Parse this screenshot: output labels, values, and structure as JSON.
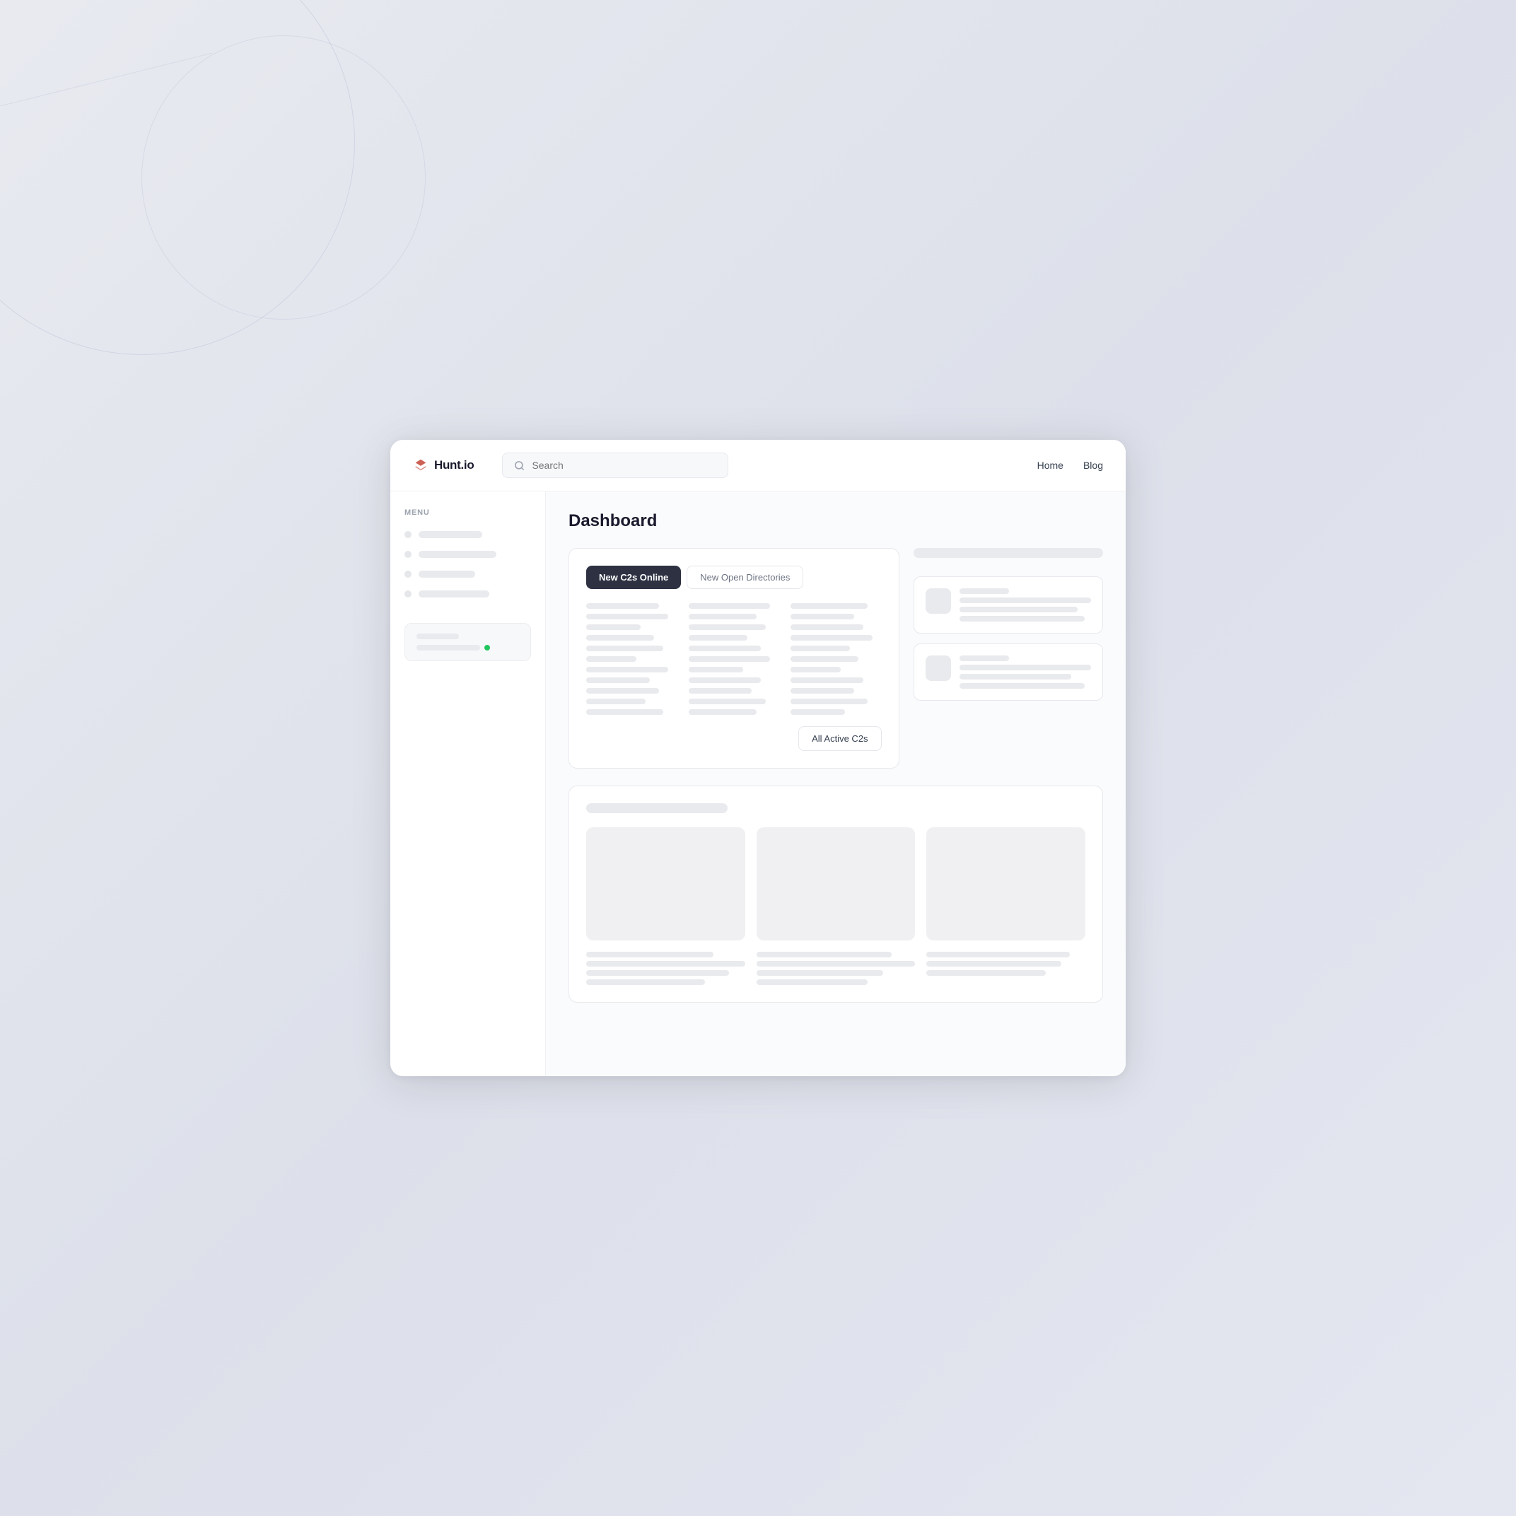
{
  "header": {
    "logo_text": "Hunt.io",
    "search_placeholder": "Search",
    "nav_links": [
      {
        "label": "Home",
        "id": "home"
      },
      {
        "label": "Blog",
        "id": "blog"
      }
    ]
  },
  "sidebar": {
    "menu_label": "Menu",
    "items": [
      {
        "id": "item1",
        "label": ""
      },
      {
        "id": "item2",
        "label": ""
      },
      {
        "id": "item3",
        "label": ""
      },
      {
        "id": "item4",
        "label": ""
      }
    ],
    "user_card": {
      "line1": "",
      "line2": "",
      "status": "online"
    }
  },
  "main": {
    "page_title": "Dashboard",
    "c2s_card": {
      "tab_active": "New C2s Online",
      "tab_inactive": "New Open Directories",
      "all_active_btn": "All Active C2s"
    },
    "right_cards": {
      "cards": [
        {
          "id": "rc1"
        },
        {
          "id": "rc2"
        }
      ]
    },
    "bottom_section": {}
  }
}
